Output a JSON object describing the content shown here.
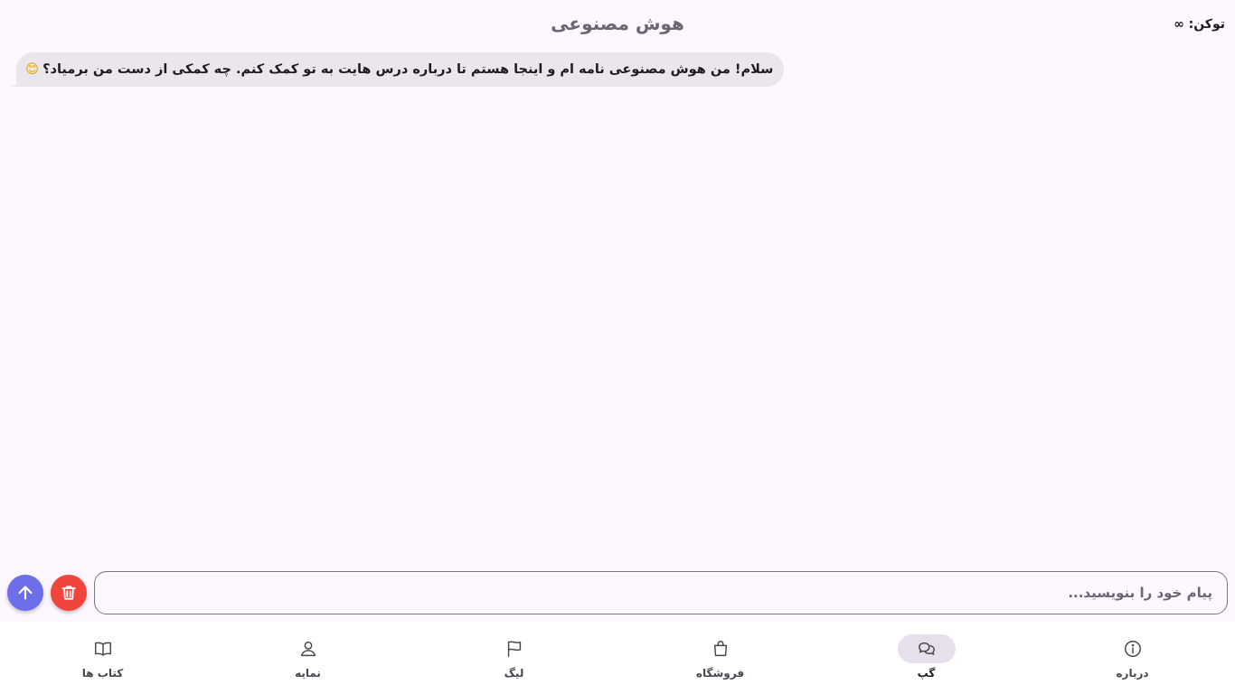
{
  "header": {
    "title": "هوش مصنوعی",
    "tokens": "توکن: ∞"
  },
  "chat": {
    "messages": [
      {
        "sender": "assistant",
        "text": "سلام! من هوش مصنوعی نامه ام و اینجا هستم تا درباره درس هایت به تو کمک کنم. چه کمکی از دست من برمیاد؟",
        "emoji": "😊"
      }
    ]
  },
  "composer": {
    "placeholder": "پیام خود را بنویسید...",
    "value": "",
    "send_icon": "arrow-up-icon",
    "clear_icon": "trash-icon"
  },
  "nav": {
    "items": [
      {
        "label": "کتاب ها",
        "icon": "book-icon",
        "active": false
      },
      {
        "label": "نمایه",
        "icon": "user-icon",
        "active": false
      },
      {
        "label": "لیگ",
        "icon": "flag-icon",
        "active": false
      },
      {
        "label": "فروشگاه",
        "icon": "shopping-bag-icon",
        "active": false
      },
      {
        "label": "گپ",
        "icon": "chat-bubbles-icon",
        "active": true
      },
      {
        "label": "درباره",
        "icon": "info-icon",
        "active": false
      }
    ]
  },
  "colors": {
    "background": "#fdf7ff",
    "send_button": "#6d6ee9",
    "clear_button": "#f0443c",
    "bubble": "#ebe6ee",
    "nav_active_pill": "#e7e0ec"
  }
}
